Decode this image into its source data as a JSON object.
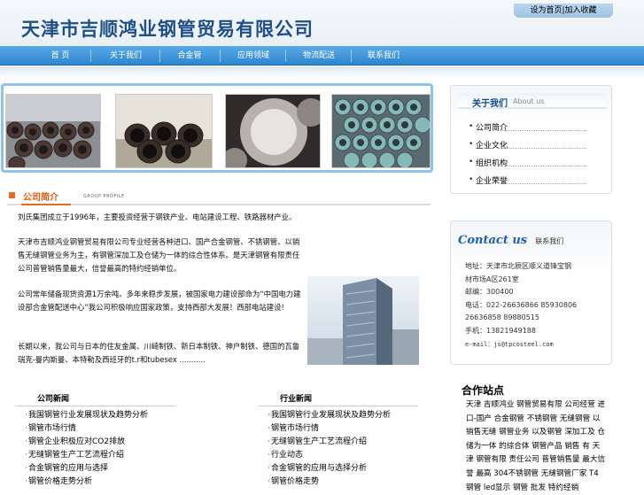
{
  "header": {
    "company_name": "天津市吉顺鸿业钢管贸易有限公司",
    "top_link": "设为首页|加入收藏"
  },
  "nav": {
    "items": [
      "首 页",
      "关于我们",
      "合金管",
      "应用领域",
      "物流配送",
      "联系我们"
    ]
  },
  "about_panel": {
    "title_cn": "关于我们",
    "title_en": "About us",
    "items": [
      "公司简介",
      "企业文化",
      "组织机构",
      "企业荣誉"
    ]
  },
  "company_intro": {
    "title_cn": "公司简介",
    "title_en": "GROUP PROFILE",
    "paragraphs": [
      "刘氏集团成立于1996年，主要投资经营于钢铁产业、电站建设工程、铁路器材产业。",
      "天津市吉顺鸿业钢管贸易有限公司专业经营各种进口、国产合金钢管、不锈钢管、以销售无缝钢管业务为主，有钢管深加工及仓储为一体的综合性体系。是天津钢管有限责任公司普管销售量最大，信誉最高的特约经销单位。",
      "公司常年储备现货资源1万余吨。多年来稳步发展，被国家电力建设部命为“中国电力建设部合金管配送中心”我公司积极响应国家政策，支持西部大发展！西部电站建设!",
      "长期以来，我公司与日本的住友金属、川崎制铁、新日本制铁、神户制铁、德国的瓦鲁瑞克-曼内斯曼、本特勒及西班牙的t.r和tubesex ..........."
    ]
  },
  "contact_panel": {
    "title_en": "Contact  us",
    "title_cn": "联系我们",
    "lines": [
      "地址：天津市北辰区顺义道锋宝钢",
      "材市场A区261室",
      "邮编：300400",
      "电话：022-26636866 85930806",
      "26636858 89880515",
      "手机：13821949188",
      "e-mail：js@tpcosteel.com"
    ]
  },
  "news_left": {
    "title": "公司新闻",
    "items": [
      "我国钢管行业发展现状及趋势分析",
      "钢管市场行情",
      "钢管企业积极应对CO2排放",
      "无缝钢管生产工艺流程介绍",
      "合金钢管的应用与选择",
      "钢管价格走势分析"
    ]
  },
  "news_right": {
    "title": "行业新闻",
    "items": [
      "我国钢管行业发展现状及趋势分析",
      "钢管市场行情",
      "无缝钢管生产工艺流程介绍",
      "行业动态",
      "合金钢管的应用与选择分析",
      "钢管价格走势"
    ]
  },
  "cooperation": {
    "title": "合作站点",
    "text": "天津 吉顺鸿业 钢管贸易有限 公司经营 进口-国产 合金钢管 不锈钢管 无缝钢管 以销售无缝 钢管业务 以及钢管 深加工及 仓储为一体 的综合体 钢管产品 销售 有 天津 钢管有限 责任公司 普管销售量 最大信誉 最高 304不锈钢管 无缝钢管厂家 T4钢管 led显示 钢管 批发 特约经销"
  },
  "colors": {
    "nav": "#2d86cf",
    "logo": "#1f4f86",
    "accent": "#e86a1c",
    "banner_border": "#8fc3ee",
    "contact_title": "#1b5fae"
  }
}
